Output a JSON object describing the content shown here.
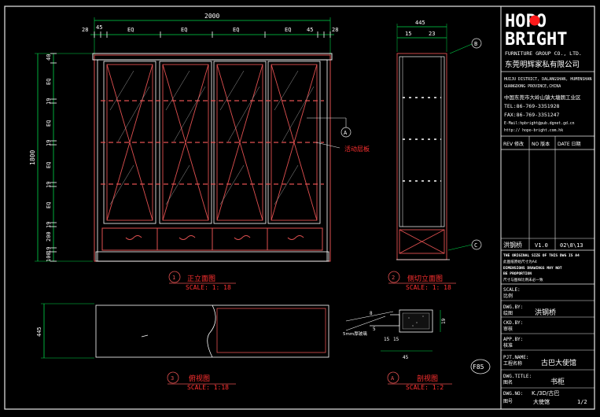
{
  "brand": {
    "logo_text_1": "HOPO",
    "logo_text_2": "BRIGHT",
    "company_en": "FURNITURE GROUP CO., LTD.",
    "company_cn": "东莞明辉家私有限公司",
    "address_en_1": "HUIJU DISTRICT, DALANGSHAN, HUMENSHAN",
    "address_en_2": "GUANGDONG PROVINCE,CHINA",
    "address_cn": "中国东莞市大岭山镇大塘朗工业区",
    "tel": "TEL:86-769-3351928",
    "fax": "FAX:86-769-3351247",
    "email": "E-Mail:hpbright@pub.dgnet.gd.cn",
    "web": "http:// hopo-bright.com.hk"
  },
  "revision_table": {
    "headers": [
      "REV 修改",
      "NO 版本",
      "DATE 日期"
    ],
    "row": [
      "洪钢桥",
      "V1.0",
      "02\\8\\13"
    ]
  },
  "notice": [
    "THE ORIGINAL SIZE OF THIS DWG IS A4",
    "此图纸原始尺寸为A4",
    "DIMENSIONS DRAWINGS MAY NOT",
    "BE PROPORTION",
    "尺寸与图样比例未必一致"
  ],
  "title_block": {
    "scale_label": "SCALE:",
    "scale_cn": "比例",
    "dwg_by_label": "DWG.BY:",
    "dwg_by_cn": "绘图",
    "dwg_by_value": "洪钢桥",
    "chk_by_label": "CKD.BY:",
    "chk_by_cn": "审核",
    "app_by_label": "APP.BY:",
    "app_by_cn": "核准",
    "project_label": "PJT.NAME:",
    "project_cn": "工程名称",
    "project_value": "古巴大使馆",
    "title_label": "DWG.TITLE:",
    "title_cn": "图名",
    "title_value": "书柜",
    "no_label": "DWG.NO:",
    "no_cn": "图号",
    "no_value_1": "K./3D/古巴",
    "no_value_2": "大使馆",
    "no_page": "1/2"
  },
  "front_view": {
    "total_width": "2000",
    "width_dims": [
      "28",
      "45",
      "EQ",
      "EQ",
      "EQ",
      "EQ",
      "45",
      "28"
    ],
    "total_height": "1800",
    "height_dims": [
      "40",
      "EQ",
      "19",
      "EQ",
      "19",
      "EQ",
      "19",
      "EQ",
      "19",
      "200",
      "19",
      "100"
    ],
    "annotation": "活动层板",
    "callout": "A",
    "label_num": "1",
    "label": "正立面图",
    "scale": "SCALE: 1: 18"
  },
  "section_view": {
    "dims": [
      "445",
      "15",
      "23"
    ],
    "callout_top": "B",
    "callout_bottom": "C",
    "label_num": "2",
    "label": "侧切立面图",
    "scale": "SCALE: 1: 18"
  },
  "plan_view": {
    "depth": "445",
    "label_num": "3",
    "label": "俯视图",
    "scale": "SCALE: 1:18"
  },
  "detail_view": {
    "dims": [
      "8",
      "15",
      "5",
      "15",
      "45",
      "19"
    ],
    "note": "5mm厚玻璃",
    "label_num": "A",
    "label": "剖视图",
    "scale": "SCALE: 1:2"
  },
  "sheet_tag": "F85"
}
